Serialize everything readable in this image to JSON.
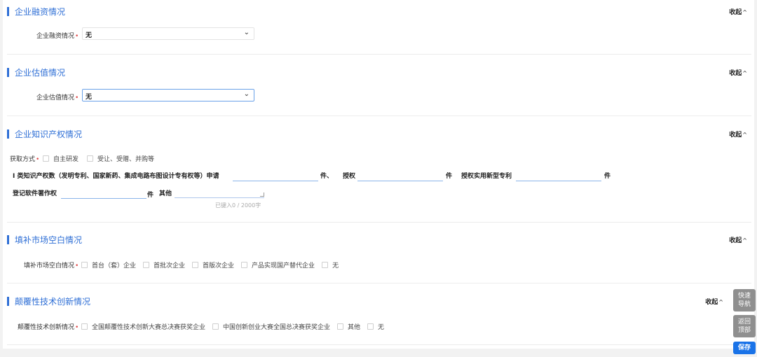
{
  "collapse_label": "收起",
  "collapse_icon": "chevron-up-icon",
  "sections": {
    "financing": {
      "title": "企业融资情况",
      "field_label": "企业融资情况",
      "required_mark": "•",
      "value": "无"
    },
    "valuation": {
      "title": "企业估值情况",
      "field_label": "企业估值情况",
      "required_mark": "•",
      "value": "无"
    },
    "ip": {
      "title": "企业知识产权情况",
      "acquire_label": "获取方式",
      "required_mark": "•",
      "acquire_options": [
        "自主研发",
        "受让、受赠、并购等"
      ],
      "class1_label": "I 类知识产权数（发明专利、国家新药、集成电路布图设计专有权等）申请",
      "unit_piece": "件",
      "unit_piece_sep": "件、",
      "granted_label": "授权",
      "utility_label": "授权实用新型专利",
      "software_label": "登记软件著作权",
      "other_label": "其他",
      "counter": "已键入0 / 2000字"
    },
    "market": {
      "title": "填补市场空白情况",
      "field_label": "填补市场空白情况",
      "required_mark": "•",
      "options": [
        "首台（套）企业",
        "首批次企业",
        "首版次企业",
        "产品实现国产替代企业",
        "无"
      ]
    },
    "disruptive": {
      "title": "颠覆性技术创新情况",
      "field_label": "颠覆性技术创新情况",
      "required_mark": "•",
      "options": [
        "全国颠覆性技术创新大赛总决赛获奖企业",
        "中国创新创业大赛全国总决赛获奖企业",
        "其他",
        "无"
      ]
    }
  },
  "floating": {
    "quick_nav_line1": "快速",
    "quick_nav_line2": "导航",
    "back_top_line1": "返回",
    "back_top_line2": "顶部",
    "save": "保存"
  },
  "colors": {
    "accent": "#2f6fd6",
    "required": "#e04a4a",
    "save_button": "#1a73e8",
    "float_button": "#8f8f8f"
  }
}
